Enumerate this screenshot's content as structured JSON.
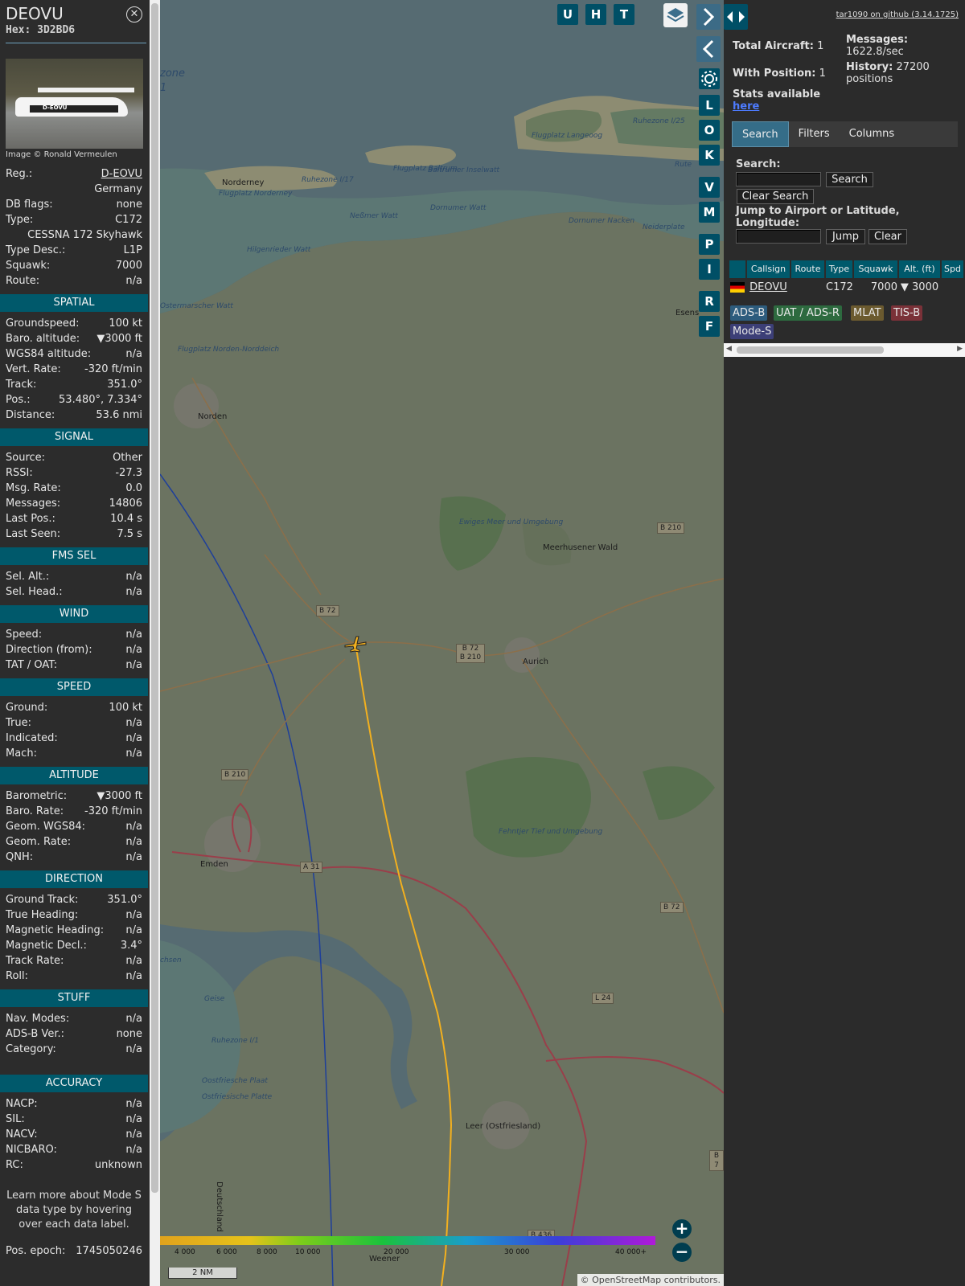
{
  "aircraft": {
    "callsign": "DEOVU",
    "hex_label": "Hex:",
    "hex": "3D2BD6",
    "photo_credit": "Image © Ronald Vermeulen",
    "photo_reg": "D-EOVU",
    "info": [
      {
        "label": "Reg.:",
        "value": "D-EOVU"
      },
      {
        "label": "",
        "value": "Germany"
      },
      {
        "label": "DB flags:",
        "value": "none"
      },
      {
        "label": "Type:",
        "value": "C172"
      },
      {
        "label": "",
        "value": "CESSNA 172 Skyhawk"
      },
      {
        "label": "Type Desc.:",
        "value": "L1P"
      },
      {
        "label": "Squawk:",
        "value": "7000"
      },
      {
        "label": "Route:",
        "value": "n/a"
      }
    ],
    "sections": [
      {
        "title": "SPATIAL",
        "rows": [
          {
            "label": "Groundspeed:",
            "value": "100 kt"
          },
          {
            "label": "Baro. altitude:",
            "value": "▼3000 ft"
          },
          {
            "label": "WGS84 altitude:",
            "value": "n/a"
          },
          {
            "label": "Vert. Rate:",
            "value": "-320 ft/min"
          },
          {
            "label": "Track:",
            "value": "351.0°"
          },
          {
            "label": "Pos.:",
            "value": "53.480°, 7.334°"
          },
          {
            "label": "Distance:",
            "value": "53.6 nmi"
          }
        ]
      },
      {
        "title": "SIGNAL",
        "rows": [
          {
            "label": "Source:",
            "value": "Other"
          },
          {
            "label": "RSSI:",
            "value": "-27.3"
          },
          {
            "label": "Msg. Rate:",
            "value": "0.0"
          },
          {
            "label": "Messages:",
            "value": "14806"
          },
          {
            "label": "Last Pos.:",
            "value": "10.4 s"
          },
          {
            "label": "Last Seen:",
            "value": "7.5 s"
          }
        ]
      },
      {
        "title": "FMS SEL",
        "rows": [
          {
            "label": "Sel. Alt.:",
            "value": "n/a"
          },
          {
            "label": "Sel. Head.:",
            "value": "n/a"
          }
        ]
      },
      {
        "title": "WIND",
        "rows": [
          {
            "label": "Speed:",
            "value": "n/a"
          },
          {
            "label": "Direction (from):",
            "value": "n/a"
          },
          {
            "label": "TAT / OAT:",
            "value": "n/a"
          }
        ]
      },
      {
        "title": "SPEED",
        "rows": [
          {
            "label": "Ground:",
            "value": "100 kt"
          },
          {
            "label": "True:",
            "value": "n/a"
          },
          {
            "label": "Indicated:",
            "value": "n/a"
          },
          {
            "label": "Mach:",
            "value": "n/a"
          }
        ]
      },
      {
        "title": "ALTITUDE",
        "rows": [
          {
            "label": "Barometric:",
            "value": "▼3000 ft"
          },
          {
            "label": "Baro. Rate:",
            "value": "-320 ft/min"
          },
          {
            "label": "Geom. WGS84:",
            "value": "n/a"
          },
          {
            "label": "Geom. Rate:",
            "value": "n/a"
          },
          {
            "label": "QNH:",
            "value": "n/a"
          }
        ]
      },
      {
        "title": "DIRECTION",
        "rows": [
          {
            "label": "Ground Track:",
            "value": "351.0°"
          },
          {
            "label": "True Heading:",
            "value": "n/a"
          },
          {
            "label": "Magnetic Heading:",
            "value": "n/a"
          },
          {
            "label": "Magnetic Decl.:",
            "value": "3.4°"
          },
          {
            "label": "Track Rate:",
            "value": "n/a"
          },
          {
            "label": "Roll:",
            "value": "n/a"
          }
        ]
      },
      {
        "title": "STUFF",
        "rows": [
          {
            "label": "Nav. Modes:",
            "value": "n/a"
          },
          {
            "label": "ADS-B Ver.:",
            "value": "none"
          },
          {
            "label": "Category:",
            "value": "n/a"
          }
        ]
      },
      {
        "title": "ACCURACY",
        "rows": [
          {
            "label": "NACP:",
            "value": "n/a"
          },
          {
            "label": "SIL:",
            "value": "n/a"
          },
          {
            "label": "NACV:",
            "value": "n/a"
          },
          {
            "label": "NICBARO:",
            "value": "n/a"
          },
          {
            "label": "RC:",
            "value": "unknown"
          }
        ]
      }
    ],
    "help_text": "Learn more about Mode S data type by hovering over each data label.",
    "pos_epoch_label": "Pos. epoch:",
    "pos_epoch": "1745050246"
  },
  "map": {
    "buttons_top": [
      "U",
      "H",
      "T"
    ],
    "buttons_side": [
      "L",
      "O",
      "K",
      "V",
      "M",
      "P",
      "I",
      "R",
      "F"
    ],
    "next_icon": "chevron-right-icon",
    "prev_icon": "chevron-left-icon",
    "settings_icon": "gear-icon",
    "layers_icon": "layers-icon",
    "expand_icon": "expand-horizontal-icon",
    "labels": [
      {
        "text": "Norderney",
        "kind": "town"
      },
      {
        "text": "Flugplatz Norderney",
        "kind": "airfield"
      },
      {
        "text": "Ruhezone I/17",
        "kind": "water"
      },
      {
        "text": "Flugplatz Baltrum",
        "kind": "airfield"
      },
      {
        "text": "Baltrumer Inselwatt",
        "kind": "water"
      },
      {
        "text": "Flugplatz Langeoog",
        "kind": "airfield"
      },
      {
        "text": "Ruhezone I/25",
        "kind": "water"
      },
      {
        "text": "Rute",
        "kind": "water"
      },
      {
        "text": "Neßmer Watt",
        "kind": "water"
      },
      {
        "text": "Dornumer Watt",
        "kind": "water"
      },
      {
        "text": "Dornumer Nacken",
        "kind": "water"
      },
      {
        "text": "Neiderplate",
        "kind": "water"
      },
      {
        "text": "Hilgenrieder Watt",
        "kind": "water"
      },
      {
        "text": "Ostermarscher Watt",
        "kind": "water"
      },
      {
        "text": "Flugplatz Norden-Norddeich",
        "kind": "airfield"
      },
      {
        "text": "Norden",
        "kind": "town"
      },
      {
        "text": "Ewiges Meer und Umgebung",
        "kind": "water"
      },
      {
        "text": "Meerhusener Wald",
        "kind": "park"
      },
      {
        "text": "Aurich",
        "kind": "town"
      },
      {
        "text": "Esens",
        "kind": "town"
      },
      {
        "text": "Emden",
        "kind": "town"
      },
      {
        "text": "Fehntjer Tief und Umgebung",
        "kind": "water"
      },
      {
        "text": "Geise",
        "kind": "water"
      },
      {
        "text": "Ruhezone I/1",
        "kind": "water"
      },
      {
        "text": "Oostfriesche Plaat",
        "kind": "water"
      },
      {
        "text": "Ostfriesische Platte",
        "kind": "water"
      },
      {
        "text": "Leer (Ostfriesland)",
        "kind": "town"
      },
      {
        "text": "Weener",
        "kind": "town"
      },
      {
        "text": "Deutschland",
        "kind": "border"
      },
      {
        "text": "zone",
        "kind": "water"
      },
      {
        "text": "1",
        "kind": "water"
      },
      {
        "text": "chsen",
        "kind": "water"
      }
    ],
    "roads": [
      "B 72",
      "B 72 B 210",
      "B 210",
      "B 210",
      "A 31",
      "B 72",
      "L 24",
      "B 7",
      "B 436"
    ],
    "colorbar_ticks": [
      "4 000",
      "6 000",
      "8 000",
      "10 000",
      "20 000",
      "30 000",
      "40 000+"
    ],
    "scale": "2 NM",
    "attribution": "© OpenStreetMap contributors.",
    "zoom_in_icon": "plus-icon",
    "zoom_out_icon": "minus-icon"
  },
  "right": {
    "github_link": "tar1090 on github (3.14.1725)",
    "total_aircraft_label": "Total Aircraft:",
    "total_aircraft": "1",
    "with_position_label": "With Position:",
    "with_position": "1",
    "messages_label": "Messages:",
    "messages_rate": "1622.8/sec",
    "history_label": "History:",
    "history_value": "27200 positions",
    "stats_text": "Stats available",
    "stats_link": "here",
    "tabs": [
      "Search",
      "Filters",
      "Columns"
    ],
    "search_label": "Search:",
    "search_button": "Search",
    "clear_search_button": "Clear Search",
    "jump_label": "Jump to Airport or Latitude, Longitude:",
    "jump_button": "Jump",
    "clear_button": "Clear",
    "table_headers": [
      "",
      "Callsign",
      "Route",
      "Type",
      "Squawk",
      "Alt. (ft)",
      "Spd"
    ],
    "table_rows": [
      {
        "flag": "flag-germany-icon",
        "callsign": "DEOVU",
        "route": "",
        "type": "C172",
        "squawk": "7000",
        "alt": "▼ 3000",
        "spd": ""
      }
    ],
    "legend": [
      {
        "text": "ADS-B",
        "color": "#2d5c7d"
      },
      {
        "text": "UAT / ADS-R",
        "color": "#2d6a3f"
      },
      {
        "text": "MLAT",
        "color": "#6b5a2f"
      },
      {
        "text": "TIS-B",
        "color": "#7a3138"
      },
      {
        "text": "Mode-S",
        "color": "#3c3f77"
      }
    ]
  }
}
